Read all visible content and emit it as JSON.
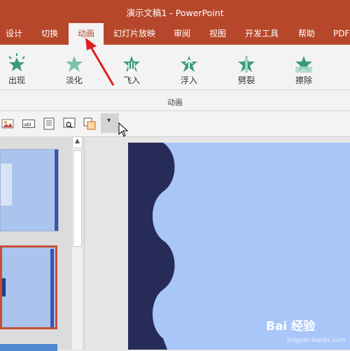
{
  "window": {
    "title": "演示文稿1  -  PowerPoint"
  },
  "tabs": [
    "设计",
    "切换",
    "动画",
    "幻灯片放映",
    "审阅",
    "视图",
    "开发工具",
    "帮助",
    "PDF工"
  ],
  "active_tab": "动画",
  "animations": [
    {
      "label": "出现",
      "icon": "appear-star-icon"
    },
    {
      "label": "淡化",
      "icon": "fade-star-icon"
    },
    {
      "label": "飞入",
      "icon": "fly-in-star-icon"
    },
    {
      "label": "浮入",
      "icon": "float-in-star-icon"
    },
    {
      "label": "劈裂",
      "icon": "split-star-icon"
    },
    {
      "label": "擦除",
      "icon": "wipe-star-icon"
    }
  ],
  "group_label": "动画",
  "toolbar": {
    "icons": [
      "picture-icon",
      "textbox-icon",
      "document-icon",
      "search-view-icon",
      "copy-format-icon"
    ],
    "overflow_glyph": "▾"
  },
  "scrollbar": {
    "up_glyph": "▲"
  },
  "watermark": {
    "brand": "Bai 经验",
    "url": "jingyan.baidu.com"
  },
  "colors": {
    "accent": "#b7472a",
    "slide_bg": "#a8c6f7",
    "wave": "#262b57",
    "star": "#3c9a7c"
  }
}
